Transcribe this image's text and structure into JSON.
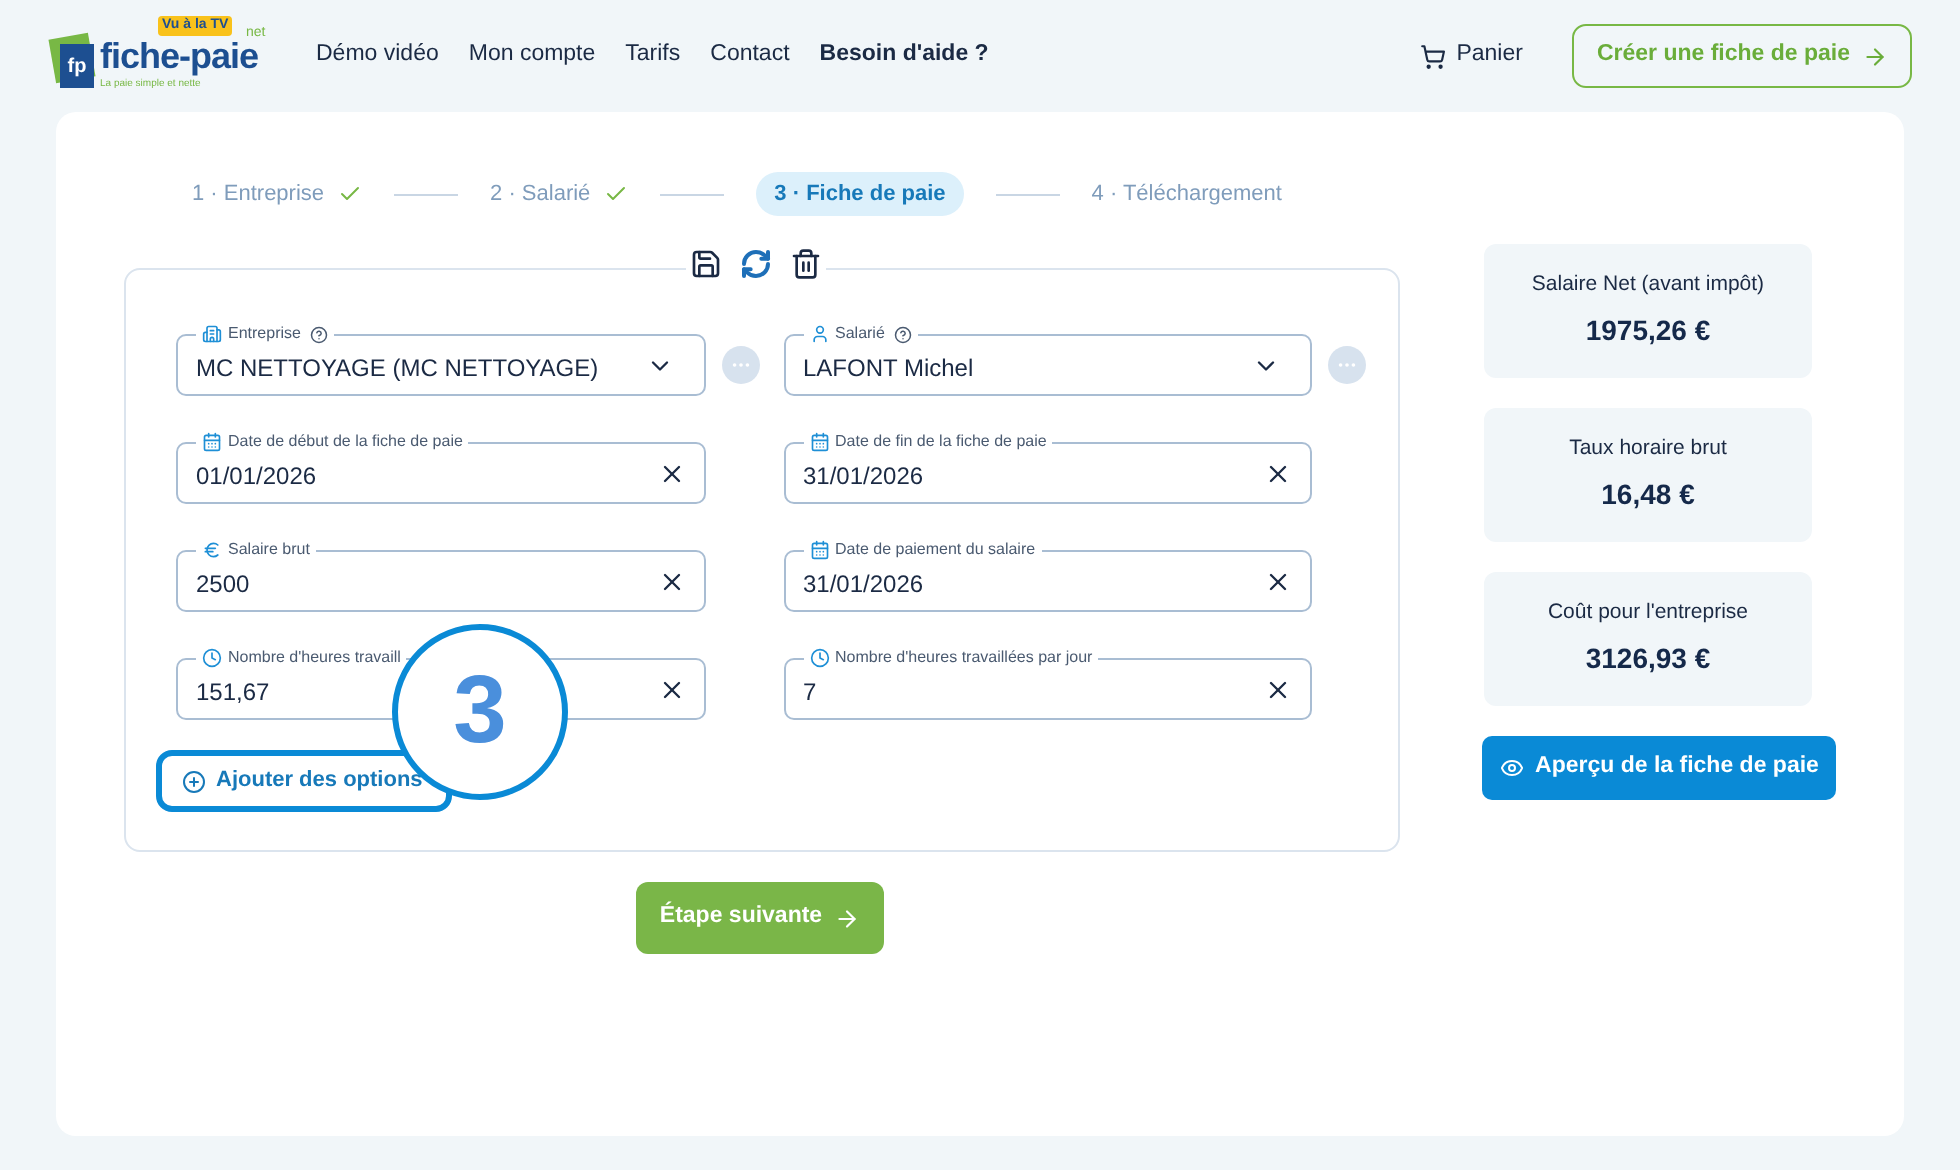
{
  "logo": {
    "mark": "fp",
    "name": "fiche-paie",
    "suffix": "net",
    "badge": "Vu à la TV",
    "tagline": "La paie simple et nette"
  },
  "nav": [
    {
      "label": "Démo vidéo",
      "bold": false
    },
    {
      "label": "Mon compte",
      "bold": false
    },
    {
      "label": "Tarifs",
      "bold": false
    },
    {
      "label": "Contact",
      "bold": false
    },
    {
      "label": "Besoin d'aide ?",
      "bold": true
    }
  ],
  "cart": {
    "label": "Panier"
  },
  "cta": {
    "label": "Créer une fiche de paie"
  },
  "steps": [
    {
      "number": "1 ·",
      "label": "Entreprise",
      "done": true,
      "selected": false
    },
    {
      "number": "2 ·",
      "label": "Salarié",
      "done": true,
      "selected": false
    },
    {
      "number": "3 ·",
      "label": "Fiche de paie",
      "done": false,
      "selected": true
    },
    {
      "number": "4 ·",
      "label": "Téléchargement",
      "done": false,
      "selected": false
    }
  ],
  "fields": [
    {
      "kind": "company-select",
      "label": "Entreprise",
      "value": "MC NETTOYAGE (MC NETTOYAGE)",
      "help": true
    },
    {
      "kind": "employee-select",
      "label": "Salarié",
      "value": "LAFONT Michel",
      "help": true
    },
    {
      "kind": "date",
      "label": "Date de début de la fiche de paie",
      "value": "01/01/2026",
      "help": false
    },
    {
      "kind": "date",
      "label": "Date de fin de la fiche de paie",
      "value": "31/01/2026",
      "help": false
    },
    {
      "kind": "amount",
      "label": "Salaire brut",
      "value": "2500",
      "help": false
    },
    {
      "kind": "date",
      "label": "Date de paiement du salaire",
      "value": "31/01/2026",
      "help": false
    },
    {
      "kind": "hours",
      "label": "Nombre d'heures travaill",
      "value": "151,67",
      "help": false
    },
    {
      "kind": "hours",
      "label": "Nombre d'heures travaillées par jour",
      "value": "7",
      "help": false
    }
  ],
  "add_options": {
    "label": "Ajouter des options"
  },
  "callout": {
    "label": "3"
  },
  "next_button": {
    "label": "Étape suivante"
  },
  "summary": [
    {
      "label": "Salaire Net (avant impôt)",
      "value": "1975,26 €"
    },
    {
      "label": "Taux horaire brut",
      "value": "16,48 €"
    },
    {
      "label": "Coût pour l'entreprise",
      "value": "3126,93 €"
    }
  ],
  "preview_button": {
    "label": "Aperçu de la fiche de paie"
  }
}
